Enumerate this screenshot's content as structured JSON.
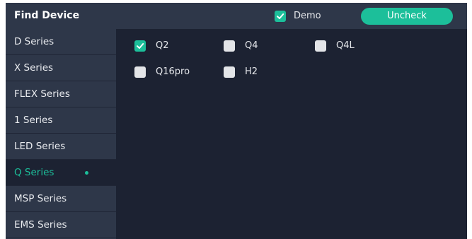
{
  "header": {
    "title": "Find Device",
    "demo_label": "Demo",
    "demo_checked": true,
    "uncheck_label": "Uncheck"
  },
  "sidebar": {
    "items": [
      {
        "label": "D Series",
        "active": false
      },
      {
        "label": "X Series",
        "active": false
      },
      {
        "label": "FLEX Series",
        "active": false
      },
      {
        "label": "1 Series",
        "active": false
      },
      {
        "label": "LED Series",
        "active": false
      },
      {
        "label": "Q Series",
        "active": true
      },
      {
        "label": "MSP Series",
        "active": false
      },
      {
        "label": "EMS Series",
        "active": false
      }
    ]
  },
  "devices": [
    {
      "label": "Q2",
      "checked": true
    },
    {
      "label": "Q4",
      "checked": false
    },
    {
      "label": "Q4L",
      "checked": false
    },
    {
      "label": "Q16pro",
      "checked": false
    },
    {
      "label": "H2",
      "checked": false
    }
  ],
  "colors": {
    "accent": "#1cbf9a",
    "panel_bg": "#1c2232",
    "sidebar_bg": "#2e3749",
    "checkbox_unchecked": "#e3e5e8"
  }
}
